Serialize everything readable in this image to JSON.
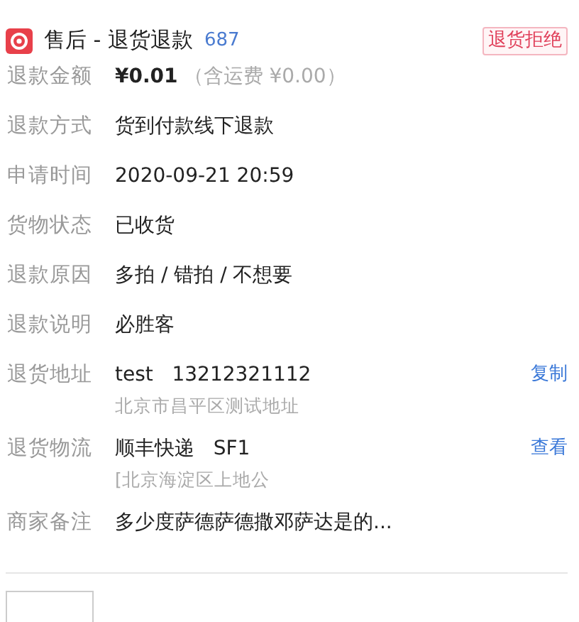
{
  "header": {
    "title": "售后 - 退货退款",
    "order_no": "687",
    "status": "退货拒绝"
  },
  "fields": [
    {
      "label": "退款金额",
      "kind": "amount",
      "amount": "¥0.01",
      "freight": "（含运费 ¥0.00）"
    },
    {
      "label": "退款方式",
      "kind": "text",
      "value": "货到付款线下退款"
    },
    {
      "label": "申请时间",
      "kind": "text",
      "value": "2020-09-21 20:59"
    },
    {
      "label": "货物状态",
      "kind": "text",
      "value": "已收货"
    },
    {
      "label": "退款原因",
      "kind": "text",
      "value": "多拍 / 错拍 / 不想要"
    },
    {
      "label": "退款说明",
      "kind": "text",
      "value": "必胜客"
    },
    {
      "label": "退货地址",
      "kind": "action",
      "value": "test   13212321112",
      "sub": "北京市昌平区测试地址",
      "action": "复制"
    },
    {
      "label": "退货物流",
      "kind": "action",
      "value": "顺丰快递   SF1",
      "sub": "[北京海淀区上地公",
      "action": "查看"
    },
    {
      "label": "商家备注",
      "kind": "text",
      "value": "多少度萨德萨德撒邓萨达是的..."
    }
  ]
}
